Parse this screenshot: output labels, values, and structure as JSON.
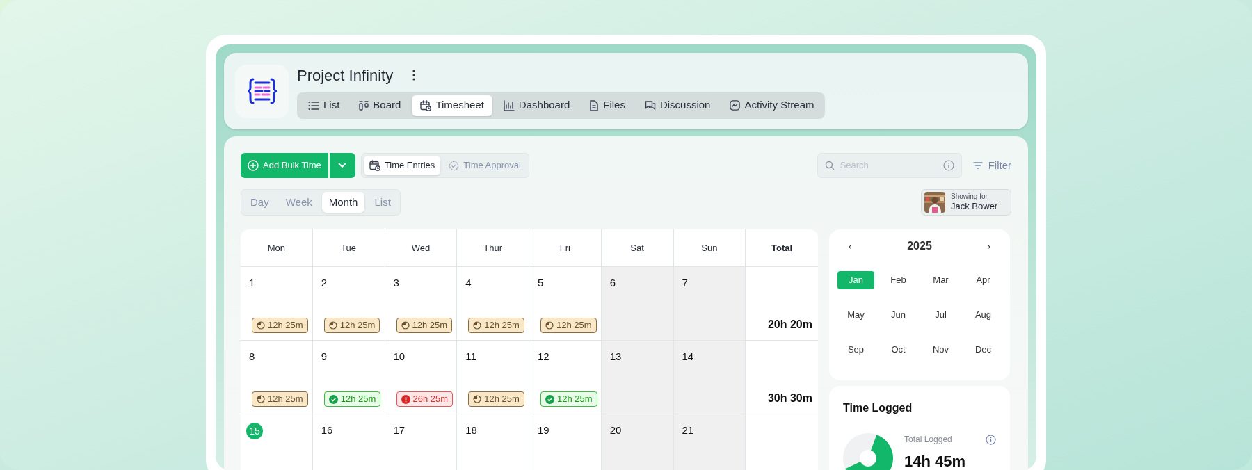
{
  "project": {
    "title": "Project Infinity"
  },
  "tabs": [
    {
      "label": "List",
      "selected": false
    },
    {
      "label": "Board",
      "selected": false
    },
    {
      "label": "Timesheet",
      "selected": true
    },
    {
      "label": "Dashboard",
      "selected": false
    },
    {
      "label": "Files",
      "selected": false
    },
    {
      "label": "Discussion",
      "selected": false
    },
    {
      "label": "Activity Stream",
      "selected": false
    }
  ],
  "toolbar": {
    "add_button": "Add Bulk Time",
    "entry_tabs": [
      {
        "label": "Time Entries",
        "selected": true
      },
      {
        "label": "Time Approval",
        "selected": false
      }
    ],
    "search": {
      "placeholder": "Search"
    },
    "filter": "Filter"
  },
  "views": [
    {
      "label": "Day",
      "selected": false
    },
    {
      "label": "Week",
      "selected": false
    },
    {
      "label": "Month",
      "selected": true
    },
    {
      "label": "List",
      "selected": false
    }
  ],
  "showing_for": {
    "caption": "Showing for",
    "name": "Jack Bower"
  },
  "calendar": {
    "columns": [
      "Mon",
      "Tue",
      "Wed",
      "Thur",
      "Fri",
      "Sat",
      "Sun",
      "Total"
    ],
    "weeks": [
      {
        "days": [
          {
            "date": "1",
            "weekend": false,
            "today": false,
            "entry": {
              "kind": "pending",
              "duration": "12h 25m"
            }
          },
          {
            "date": "2",
            "weekend": false,
            "today": false,
            "entry": {
              "kind": "pending",
              "duration": "12h 25m"
            }
          },
          {
            "date": "3",
            "weekend": false,
            "today": false,
            "entry": {
              "kind": "pending",
              "duration": "12h 25m"
            }
          },
          {
            "date": "4",
            "weekend": false,
            "today": false,
            "entry": {
              "kind": "pending",
              "duration": "12h 25m"
            }
          },
          {
            "date": "5",
            "weekend": false,
            "today": false,
            "entry": {
              "kind": "pending",
              "duration": "12h 25m"
            }
          },
          {
            "date": "6",
            "weekend": true,
            "today": false
          },
          {
            "date": "7",
            "weekend": true,
            "today": false
          }
        ],
        "total": "20h 20m"
      },
      {
        "days": [
          {
            "date": "8",
            "weekend": false,
            "today": false,
            "entry": {
              "kind": "pending",
              "duration": "12h 25m"
            }
          },
          {
            "date": "9",
            "weekend": false,
            "today": false,
            "entry": {
              "kind": "approved",
              "duration": "12h 25m"
            }
          },
          {
            "date": "10",
            "weekend": false,
            "today": false,
            "entry": {
              "kind": "rejected",
              "duration": "26h 25m"
            }
          },
          {
            "date": "11",
            "weekend": false,
            "today": false,
            "entry": {
              "kind": "pending",
              "duration": "12h 25m"
            }
          },
          {
            "date": "12",
            "weekend": false,
            "today": false,
            "entry": {
              "kind": "approved",
              "duration": "12h 25m"
            }
          },
          {
            "date": "13",
            "weekend": true,
            "today": false
          },
          {
            "date": "14",
            "weekend": true,
            "today": false
          }
        ],
        "total": "30h 30m"
      },
      {
        "days": [
          {
            "date": "15",
            "weekend": false,
            "today": true
          },
          {
            "date": "16",
            "weekend": false,
            "today": false
          },
          {
            "date": "17",
            "weekend": false,
            "today": false
          },
          {
            "date": "18",
            "weekend": false,
            "today": false
          },
          {
            "date": "19",
            "weekend": false,
            "today": false
          },
          {
            "date": "20",
            "weekend": true,
            "today": false
          },
          {
            "date": "21",
            "weekend": true,
            "today": false
          }
        ]
      }
    ]
  },
  "year_picker": {
    "year": "2025",
    "prev": "‹",
    "next": "›",
    "months": [
      {
        "label": "Jan",
        "selected": true
      },
      {
        "label": "Feb",
        "selected": false
      },
      {
        "label": "Mar",
        "selected": false
      },
      {
        "label": "Apr",
        "selected": false
      },
      {
        "label": "May",
        "selected": false
      },
      {
        "label": "Jun",
        "selected": false
      },
      {
        "label": "Jul",
        "selected": false
      },
      {
        "label": "Aug",
        "selected": false
      },
      {
        "label": "Sep",
        "selected": false
      },
      {
        "label": "Oct",
        "selected": false
      },
      {
        "label": "Nov",
        "selected": false
      },
      {
        "label": "Dec",
        "selected": false
      }
    ]
  },
  "time_logged": {
    "title": "Time Logged",
    "caption": "Total Logged",
    "value": "14h 45m"
  }
}
